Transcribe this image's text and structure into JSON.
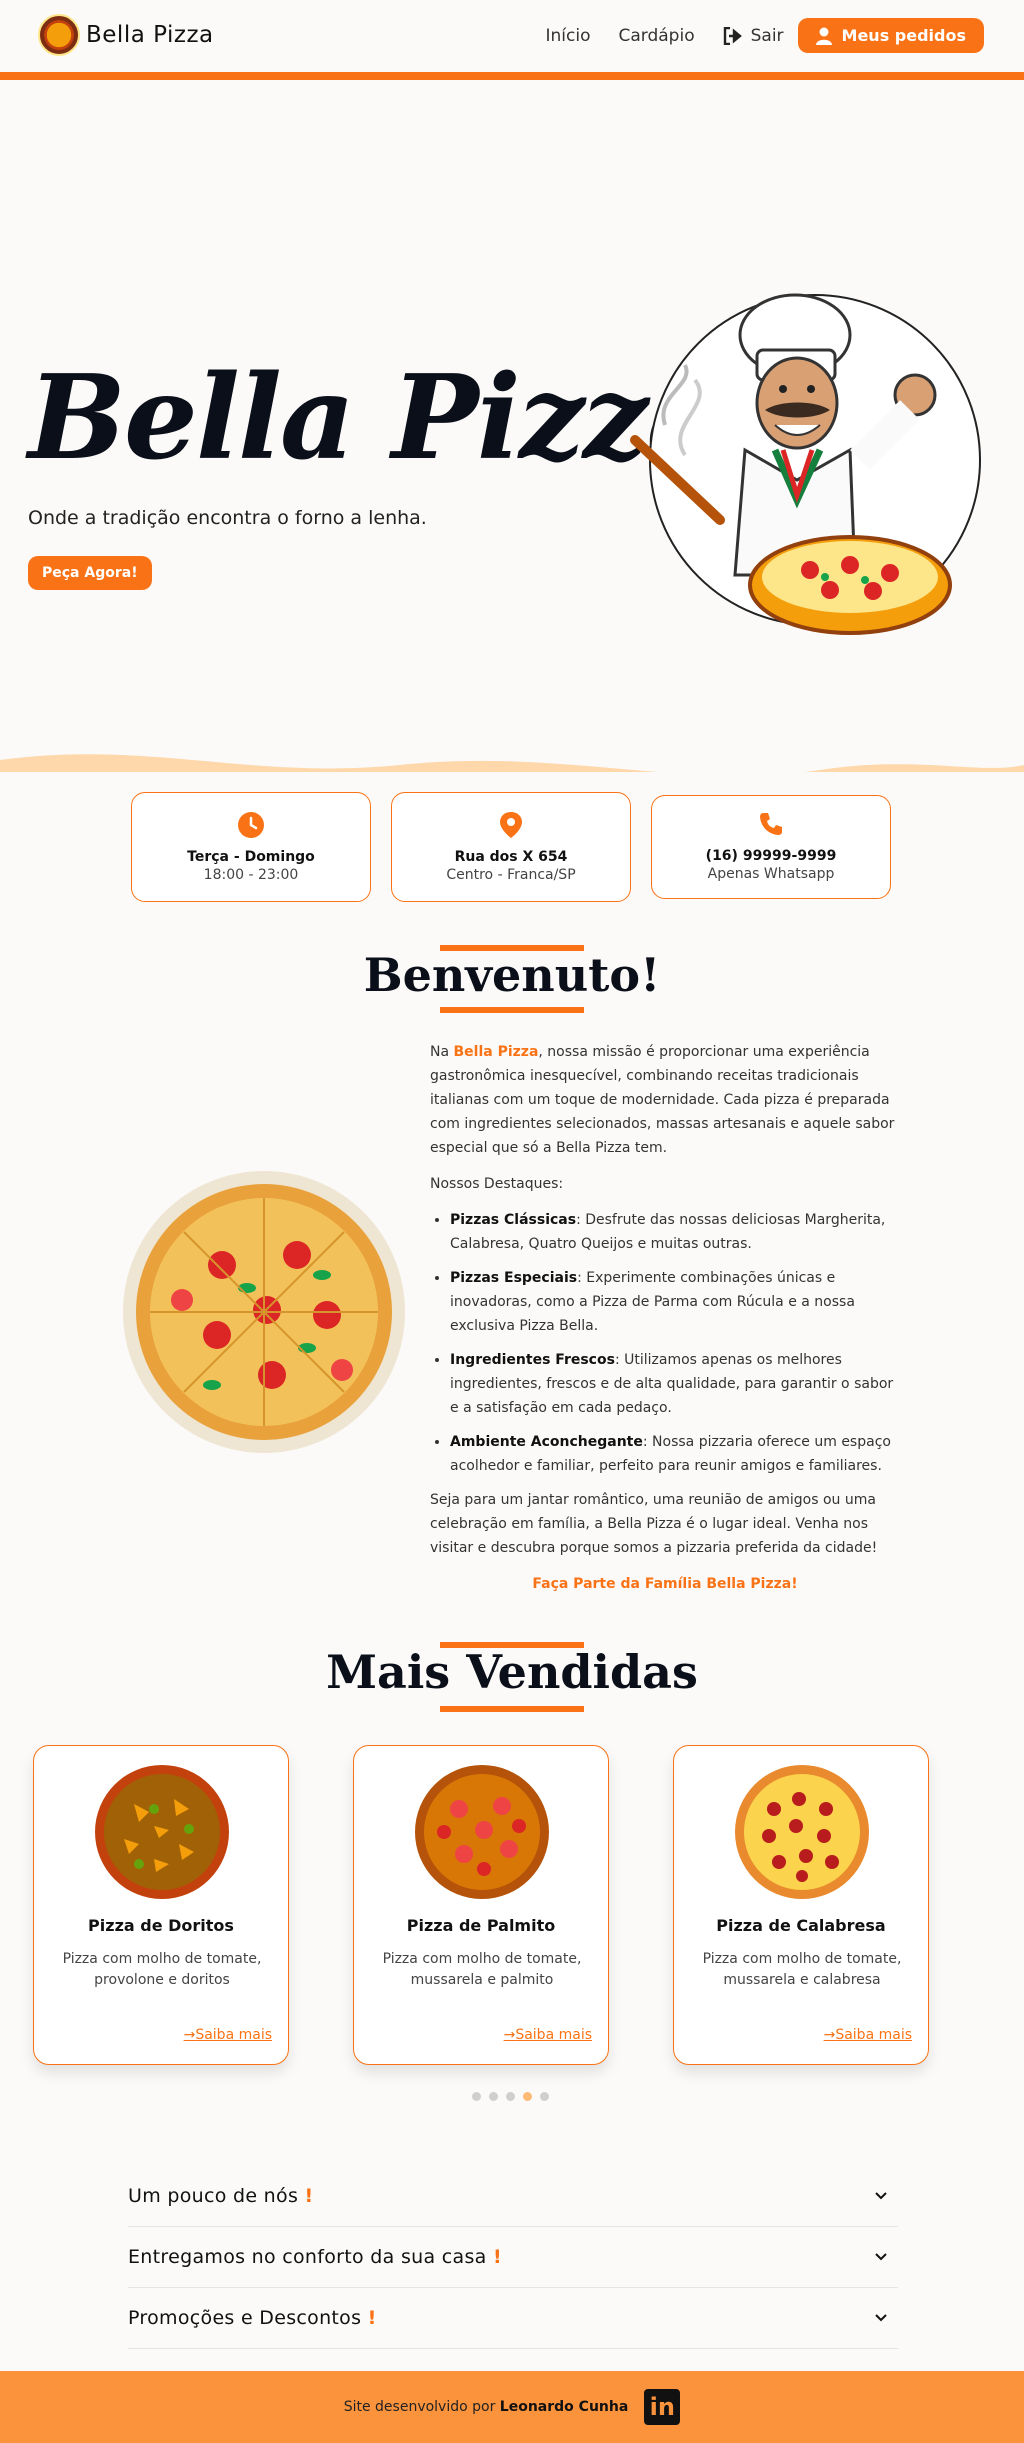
{
  "header": {
    "brand": "Bella Pizza",
    "nav": [
      "Início",
      "Cardápio"
    ],
    "logout": "Sair",
    "orders_button": "Meus pedidos"
  },
  "hero": {
    "title": "Bella Pizza",
    "subtitle": "Onde a tradição encontra o forno a lenha.",
    "cta": "Peça Agora!"
  },
  "info": [
    {
      "icon": "clock-icon",
      "title": "Terça - Domingo",
      "detail": "18:00 - 23:00"
    },
    {
      "icon": "location-pin-icon",
      "title": "Rua dos X 654",
      "detail": "Centro - Franca/SP"
    },
    {
      "icon": "phone-icon",
      "title": "(16) 99999-9999",
      "detail": "Apenas Whatsapp"
    }
  ],
  "welcome": {
    "title": "Benvenuto!",
    "intro_prefix": "Na ",
    "intro_brand": "Bella Pizza",
    "intro_rest": ", nossa missão é proporcionar uma experiência gastronômica inesquecível, combinando receitas tradicionais italianas com um toque de modernidade. Cada pizza é preparada com ingredientes selecionados, massas artesanais e aquele sabor especial que só a Bella Pizza tem.",
    "highlights_title": "Nossos Destaques:",
    "highlights": [
      {
        "term": "Pizzas Clássicas",
        "text": ": Desfrute das nossas deliciosas Margherita, Calabresa, Quatro Queijos e muitas outras."
      },
      {
        "term": "Pizzas Especiais",
        "text": ": Experimente combinações únicas e inovadoras, como a Pizza de Parma com Rúcula e a nossa exclusiva Pizza Bella."
      },
      {
        "term": "Ingredientes Frescos",
        "text": ": Utilizamos apenas os melhores ingredientes, frescos e de alta qualidade, para garantir o sabor e a satisfação em cada pedaço."
      },
      {
        "term": "Ambiente Aconchegante",
        "text": ": Nossa pizzaria oferece um espaço acolhedor e familiar, perfeito para reunir amigos e familiares."
      }
    ],
    "closing": "Seja para um jantar romântico, uma reunião de amigos ou uma celebração em família, a Bella Pizza é o lugar ideal. Venha nos visitar e descubra porque somos a pizzaria preferida da cidade!",
    "cta": "Faça Parte da Família Bella Pizza!"
  },
  "bestsellers": {
    "title": "Mais Vendidas",
    "items": [
      {
        "name": "Pizza de Doritos",
        "desc": "Pizza com molho de tomate, provolone e doritos",
        "link": "Saiba mais"
      },
      {
        "name": "Pizza de Palmito",
        "desc": "Pizza com molho de tomate, mussarela e palmito",
        "link": "Saiba mais"
      },
      {
        "name": "Pizza de Calabresa",
        "desc": "Pizza com molho de tomate, mussarela e calabresa",
        "link": "Saiba mais"
      }
    ],
    "carousel_pages": 5,
    "carousel_active_index": 3
  },
  "accordion": [
    {
      "label": "Um pouco de nós",
      "mark": "!"
    },
    {
      "label": "Entregamos no conforto da sua casa",
      "mark": "!"
    },
    {
      "label": "Promoções e Descontos",
      "mark": "!"
    }
  ],
  "footer": {
    "prefix": "Site desenvolvido por ",
    "author": "Leonardo Cunha",
    "social_icon": "linkedin-icon",
    "social_label": "in"
  },
  "colors": {
    "accent": "#f97316",
    "footer": "#fb923c",
    "text_dark": "#0b0f1a"
  }
}
